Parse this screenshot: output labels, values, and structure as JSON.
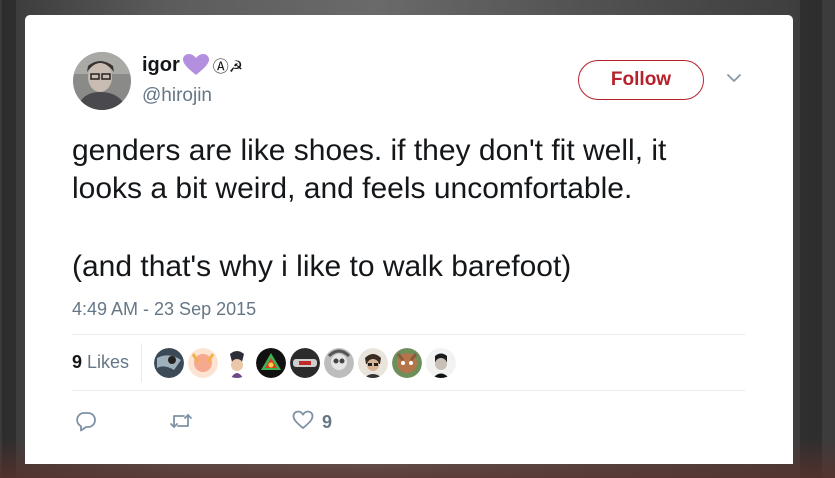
{
  "tweet": {
    "author": {
      "display_name": "igor",
      "name_symbols": "Ⓐ☭",
      "handle": "@hirojin"
    },
    "follow_label": "Follow",
    "text_lines": [
      "genders are like shoes. if they don't fit well, it",
      "looks a bit weird, and feels uncomfortable.",
      "",
      "(and that's why i like to walk barefoot)"
    ],
    "timestamp": "4:49 AM - 23 Sep 2015",
    "likes": {
      "count": "9",
      "label": "Likes"
    },
    "like_count": "9",
    "icons": {
      "heart_emoji": "purple-heart-icon",
      "menu": "chevron-down-icon",
      "reply": "reply-icon",
      "retweet": "retweet-icon",
      "like": "like-heart-icon"
    },
    "colors": {
      "follow_accent": "#b5222b",
      "muted_text": "#657786",
      "primary_text": "#14171a",
      "heart_emoji": "#b48fe0",
      "action_icon": "#7d92a6"
    }
  }
}
